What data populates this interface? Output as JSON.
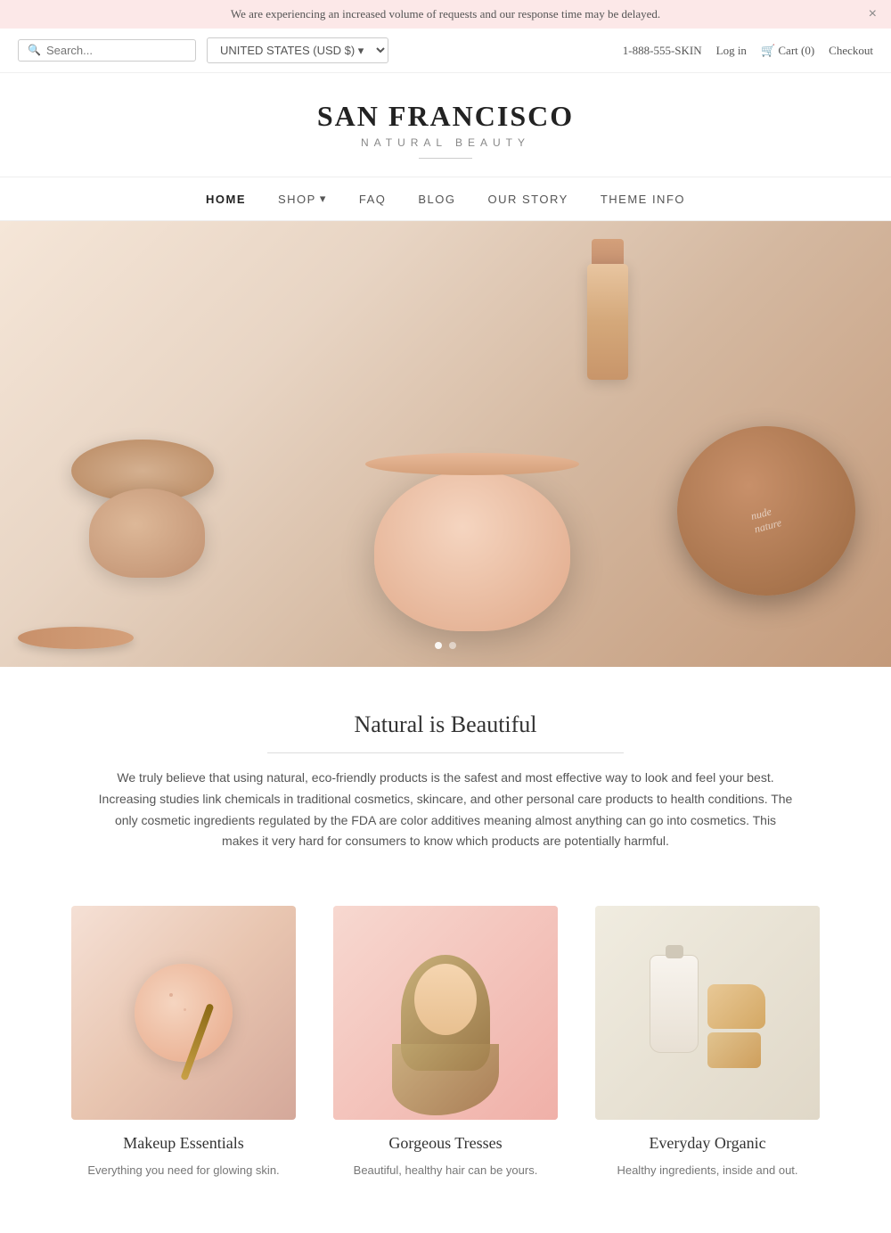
{
  "announcement": {
    "text": "We are experiencing an increased volume of requests and our response time may be delayed.",
    "close_label": "×"
  },
  "topbar": {
    "search_placeholder": "Search...",
    "currency": "UNITED STATES (USD $)",
    "phone": "1-888-555-SKIN",
    "login_label": "Log in",
    "cart_label": "Cart (0)",
    "checkout_label": "Checkout"
  },
  "logo": {
    "title": "SAN FRANCISCO",
    "subtitle": "NATURAL BEAUTY"
  },
  "nav": {
    "items": [
      {
        "label": "HOME",
        "active": true
      },
      {
        "label": "SHOP",
        "has_dropdown": true
      },
      {
        "label": "FAQ",
        "active": false
      },
      {
        "label": "BLOG",
        "active": false
      },
      {
        "label": "OUR STORY",
        "active": false
      },
      {
        "label": "THEME INFO",
        "active": false
      }
    ]
  },
  "slider": {
    "dots": [
      {
        "active": true
      },
      {
        "active": false
      }
    ]
  },
  "section": {
    "heading": "Natural is Beautiful",
    "description": "We truly believe that using natural, eco-friendly products is the safest and most effective way to look and feel your best. Increasing studies link chemicals in traditional cosmetics, skincare, and other personal care products to health conditions. The only cosmetic ingredients regulated by the FDA are color additives meaning almost anything can go into cosmetics. This makes it very hard for consumers to know which products are potentially harmful."
  },
  "products": [
    {
      "title": "Makeup Essentials",
      "description": "Everything you need for glowing skin.",
      "type": "makeup"
    },
    {
      "title": "Gorgeous Tresses",
      "description": "Beautiful, healthy hair can be yours.",
      "type": "hair"
    },
    {
      "title": "Everyday Organic",
      "description": "Healthy ingredients, inside and out.",
      "type": "organic"
    }
  ]
}
